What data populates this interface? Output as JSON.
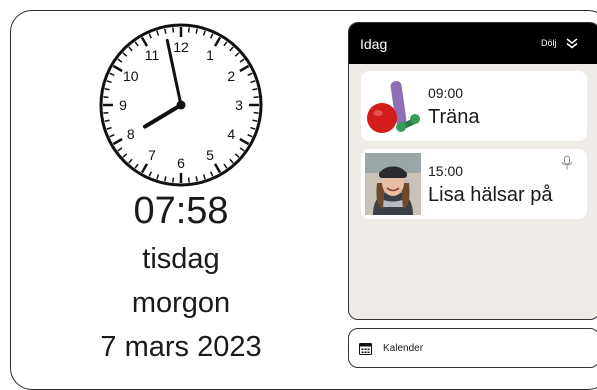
{
  "clock": {
    "numerals": [
      "12",
      "1",
      "2",
      "3",
      "4",
      "5",
      "6",
      "7",
      "8",
      "9",
      "10",
      "11"
    ],
    "hour": 7,
    "minute": 58
  },
  "datetime": {
    "time": "07:58",
    "weekday": "tisdag",
    "period": "morgon",
    "date": "7 mars 2023"
  },
  "today": {
    "title": "Idag",
    "hide_label": "Dölj",
    "events": [
      {
        "time": "09:00",
        "title": "Träna",
        "icon": "exercise-weights-image"
      },
      {
        "time": "15:00",
        "title": "Lisa hälsar på",
        "icon": "person-photo",
        "has_voice": true
      }
    ]
  },
  "calendar_button": {
    "label": "Kalender",
    "icon": "calendar-icon"
  },
  "colors": {
    "panel_bg": "#efebe6",
    "header_bg": "#000000",
    "card_bg": "#ffffff",
    "text": "#1a1a1a"
  }
}
